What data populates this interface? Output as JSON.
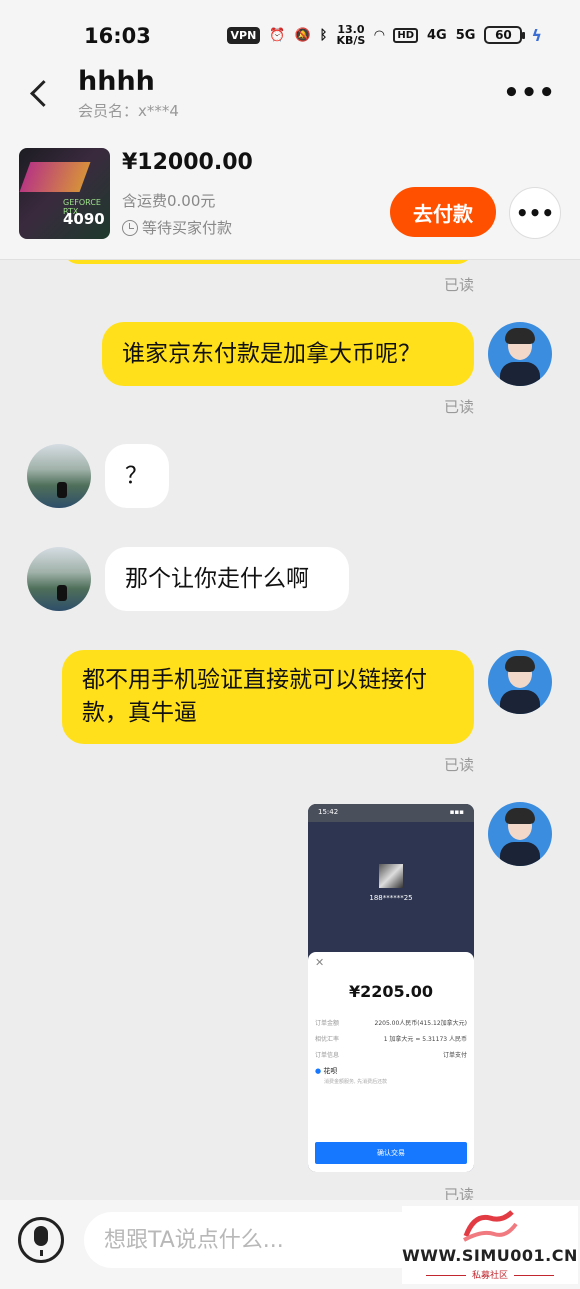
{
  "status_bar": {
    "time": "16:03",
    "vpn": "VPN",
    "net_speed_value": "13.0",
    "net_speed_unit": "KB/S",
    "hd": "HD",
    "signal_1": "4G",
    "signal_2": "5G",
    "battery": "60"
  },
  "header": {
    "name": "hhhh",
    "member": "会员名：x***4"
  },
  "product": {
    "thumb_brand": "GEFORCE RTX",
    "thumb_model": "4090",
    "price": "¥12000.00",
    "shipping": "含运费0.00元",
    "status": "等待买家付款",
    "pay_button": "去付款"
  },
  "messages": [
    {
      "from": "me",
      "text": "",
      "read": "已读"
    },
    {
      "from": "me",
      "text": "谁家京东付款是加拿大币呢？",
      "read": "已读"
    },
    {
      "from": "them",
      "text": "？"
    },
    {
      "from": "them",
      "text": "那个让你走什么啊"
    },
    {
      "from": "me",
      "text": "都不用手机验证直接就可以链接付款，真牛逼",
      "read": "已读"
    },
    {
      "from": "me",
      "type": "image",
      "read": "已读"
    }
  ],
  "screenshot": {
    "time": "15:42",
    "account": "188******25",
    "amount": "¥2205.00",
    "rows": [
      {
        "key": "订单金额",
        "value": "2205.00人民币(415.12加拿大元)"
      },
      {
        "key": "相优汇率",
        "value": "1 加拿大元 = 5.31173 人民币"
      },
      {
        "key": "订单信息",
        "value": "订单支付"
      }
    ],
    "method": "花呗",
    "method_sub": "消费金额服务, 先消费后还款",
    "confirm": "确认交易"
  },
  "input": {
    "placeholder": "想跟TA说点什么..."
  },
  "watermark": {
    "url": "WWW.SIMU001.CN",
    "sub": "私募社区"
  },
  "colors": {
    "accent_orange": "#ff5000",
    "my_bubble": "#ffe01b",
    "confirm_blue": "#1677ff"
  }
}
